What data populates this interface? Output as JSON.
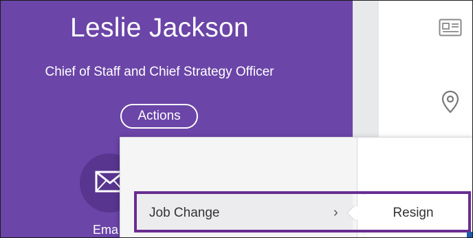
{
  "profile": {
    "name": "Leslie Jackson",
    "title": "Chief of Staff and Chief Strategy Officer",
    "actions_label": "Actions",
    "email_label": "Ema"
  },
  "menu": {
    "items": [
      {
        "label": "Job Change",
        "chevron": "›"
      }
    ],
    "submenu": [
      {
        "label": "Resign"
      }
    ]
  },
  "icons": {
    "email": "envelope-icon",
    "id_card": "id-card-icon",
    "location": "location-pin-icon"
  },
  "colors": {
    "panel": "#6b45a8",
    "highlight": "#6a2c91"
  }
}
